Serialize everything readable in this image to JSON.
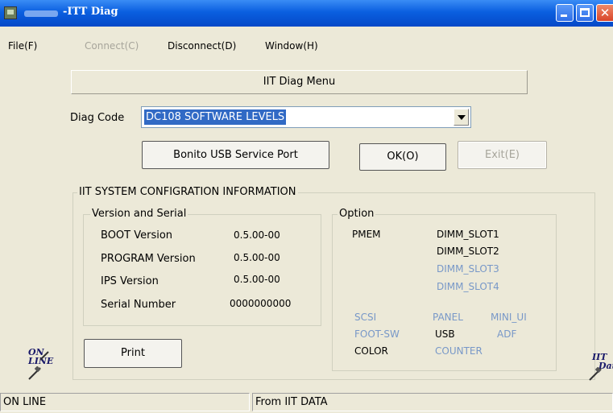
{
  "window": {
    "title": "-ITT Diag"
  },
  "menu": {
    "file": "File(F)",
    "connect": "Connect(C)",
    "disconnect": "Disconnect(D)",
    "window": "Window(H)"
  },
  "header": {
    "banner": "IIT Diag Menu"
  },
  "diag": {
    "label": "Diag Code",
    "selected": "DC108 SOFTWARE LEVELS"
  },
  "buttons": {
    "usb_port": "Bonito USB Service Port",
    "ok": "OK(O)",
    "exit": "Exit(E)",
    "print": "Print"
  },
  "config": {
    "title": "IIT SYSTEM CONFIGRATION INFORMATION",
    "version_group": {
      "title": "Version and Serial",
      "rows": [
        {
          "label": "BOOT Version",
          "value": "0.5.00-00"
        },
        {
          "label": "PROGRAM Version",
          "value": "0.5.00-00"
        },
        {
          "label": "IPS Version",
          "value": "0.5.00-00"
        },
        {
          "label": "Serial Number",
          "value": "0000000000"
        }
      ]
    },
    "option_group": {
      "title": "Option",
      "pmem_label": "PMEM",
      "dimm": [
        "DIMM_SLOT1",
        "DIMM_SLOT2",
        "DIMM_SLOT3",
        "DIMM_SLOT4"
      ],
      "scsi": "SCSI",
      "panel": "PANEL",
      "mini_ui": "MINI_UI",
      "foot_sw": "FOOT-SW",
      "usb": "USB",
      "adf": "ADF",
      "color": "COLOR",
      "counter": "COUNTER"
    }
  },
  "logos": {
    "online_line1": "ON",
    "online_line2": "LINE",
    "iit_line1": "IIT",
    "iit_line2": "Data"
  },
  "status": {
    "left": "ON LINE",
    "right": "From IIT DATA"
  },
  "colors": {
    "title_bar": "#0a5fe0",
    "selection": "#316ac5",
    "disabled_option": "#7898c8",
    "background": "#ece9d8"
  }
}
